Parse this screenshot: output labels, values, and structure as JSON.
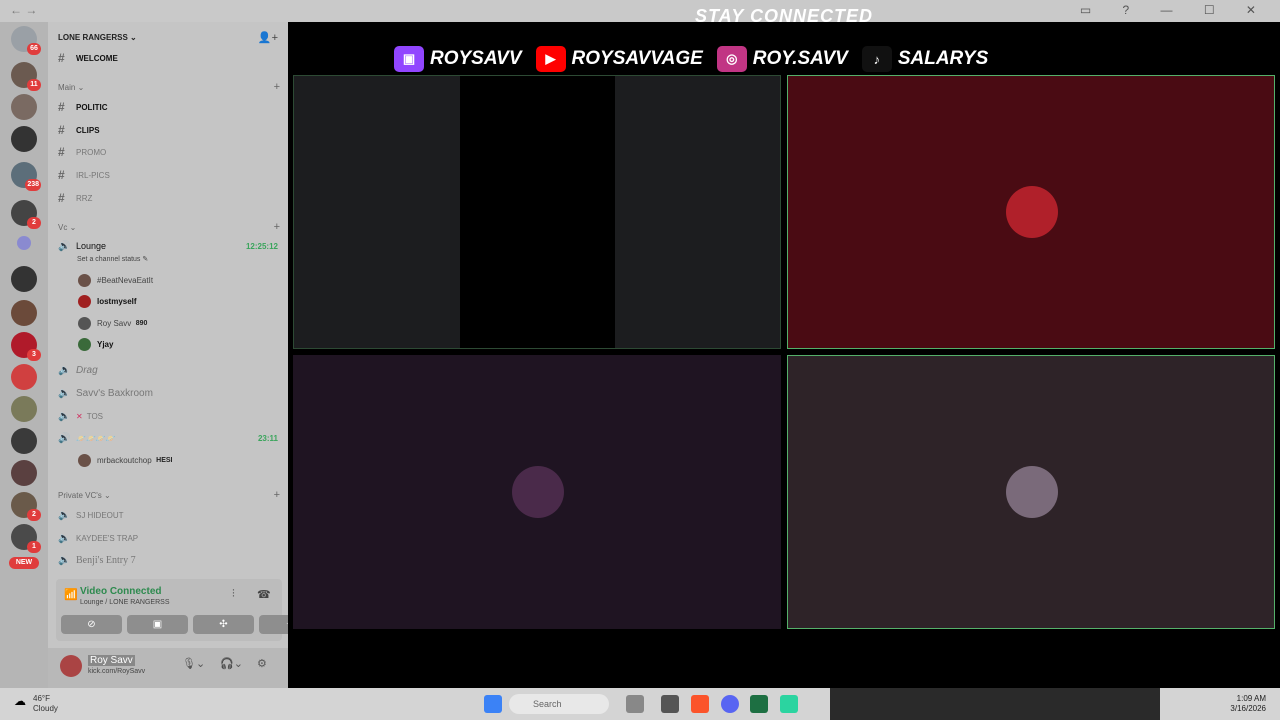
{
  "banner": {
    "title": "STAY CONNECTED"
  },
  "socials": [
    {
      "platform": "twitch-icon",
      "handle": "ROYSAVV",
      "color": "#9146ff"
    },
    {
      "platform": "youtube-icon",
      "handle": "ROYSAVVAGE",
      "color": "#ff0000"
    },
    {
      "platform": "instagram-icon",
      "handle": "ROY.SAVV",
      "color": "#c13584"
    },
    {
      "platform": "tiktok-icon",
      "handle": "SALARYS",
      "color": "#111111"
    }
  ],
  "server": {
    "name": "LONE RANGERSS"
  },
  "server_badges": {
    "home": "66",
    "s1": "11",
    "s4": "238",
    "s5": "2",
    "s11": "3",
    "s16": "2",
    "s17": "1",
    "new": "NEW"
  },
  "channels": {
    "welcome": "WELCOME",
    "cat_main": "Main",
    "politic": "POLITIC",
    "clips": "CLIPS",
    "promo": "PROMO",
    "irl_pics": "IRL-PICS",
    "rrz": "RRZ",
    "cat_vc": "Vc",
    "lounge": "Lounge",
    "lounge_timer": "12:25:12",
    "lounge_status": "Set a channel status",
    "drag": "Drag",
    "baxkroom": "Savv's Baxkroom",
    "tos": "TOS",
    "vc4": "🪐🪐🪐🪐",
    "vc4_timer": "23:11",
    "cat_private": "Private VC's",
    "sj": "SJ HIDEOUT",
    "kaydee": "KAYDEE'S TRAP",
    "benji": "Benji's Entry 7"
  },
  "members": {
    "m1": "#BeatNevaEatIt",
    "m2": "lostmyself",
    "m3": "Roy Savv",
    "m3_tag": "890",
    "m4": "Yjay",
    "m5": "mrbackoutchop",
    "m5_tag": "HESI"
  },
  "voice": {
    "title": "Video Connected",
    "subtitle": "Lounge / LONE RANGERSS"
  },
  "user": {
    "name": "Roy Savv",
    "status": "kick.com/RoySavv"
  },
  "taskbar": {
    "temp": "46°F",
    "weather": "Cloudy",
    "search": "Search",
    "time": "1:09 AM",
    "date": "3/16/2026"
  },
  "colors": {
    "tile2": "#4a0b13",
    "tile3": "#1f1422",
    "tile4": "#2e2328",
    "tile1": "#1c1d1f",
    "green": "#3aa55c"
  }
}
